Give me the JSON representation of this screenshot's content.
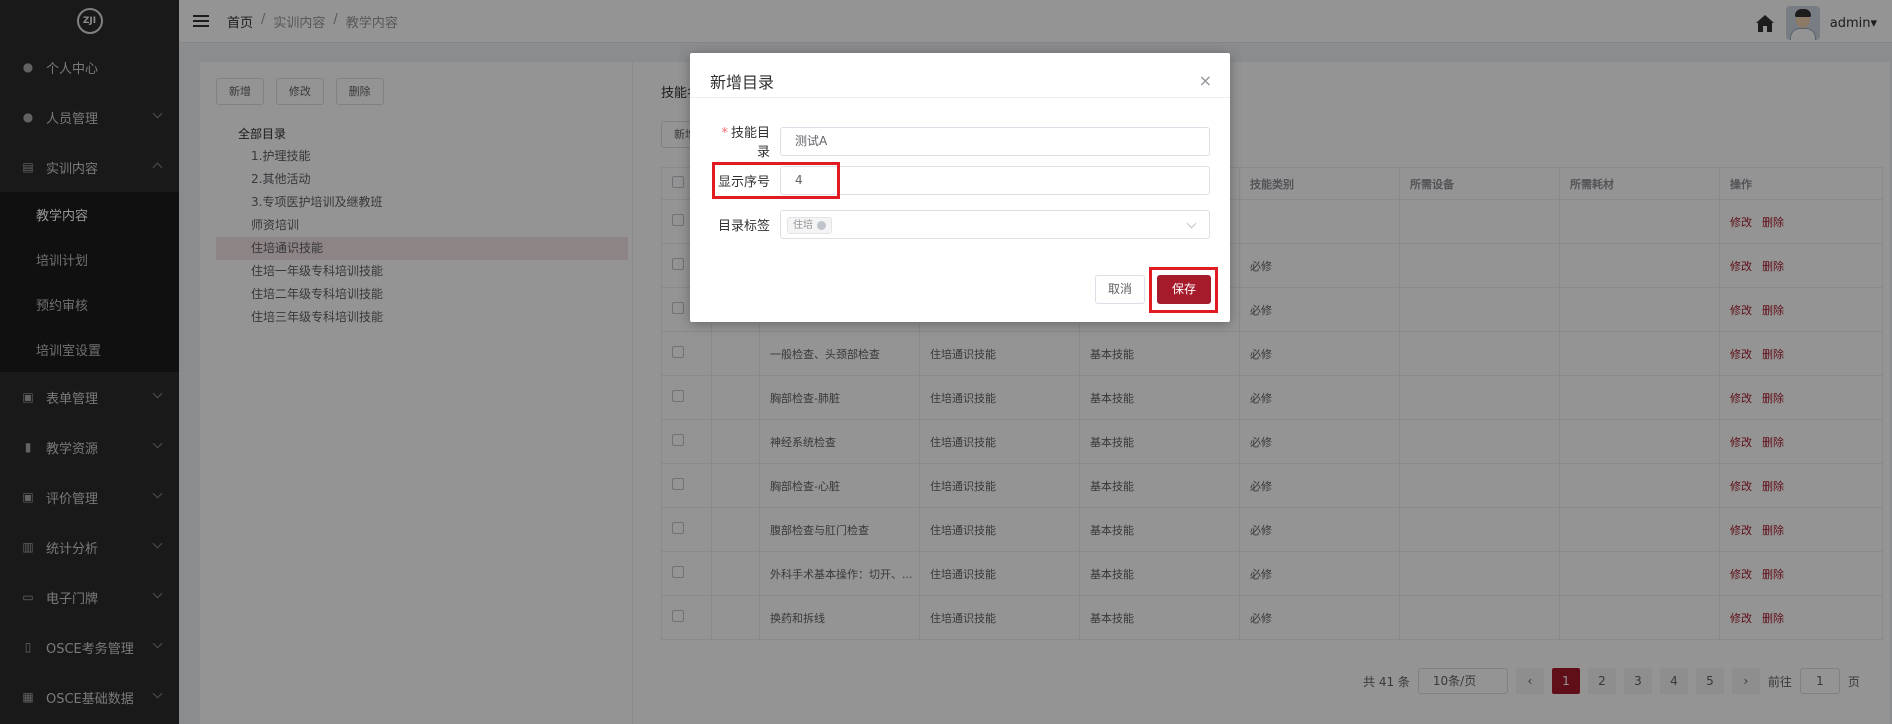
{
  "logo": {
    "text": "ZJI"
  },
  "header": {
    "breadcrumb": [
      "首页",
      "/",
      "实训内容",
      "/",
      "教学内容"
    ],
    "user": "admin▾"
  },
  "sidebar": {
    "items": [
      {
        "label": "个人中心",
        "icon": "user-icon"
      },
      {
        "label": "人员管理",
        "icon": "users-icon"
      },
      {
        "label": "实训内容",
        "icon": "book-icon"
      },
      {
        "label": "表单管理",
        "icon": "form-icon"
      },
      {
        "label": "教学资源",
        "icon": "resource-icon"
      },
      {
        "label": "评价管理",
        "icon": "evaluate-icon"
      },
      {
        "label": "统计分析",
        "icon": "chart-icon"
      },
      {
        "label": "电子门牌",
        "icon": "monitor-icon"
      },
      {
        "label": "OSCE考务管理",
        "icon": "doc-icon"
      },
      {
        "label": "OSCE基础数据",
        "icon": "grid-icon"
      }
    ],
    "sub": [
      "教学内容",
      "培训计划",
      "预约审核",
      "培训室设置"
    ]
  },
  "tree": {
    "buttons": [
      "新增",
      "修改",
      "删除"
    ],
    "root": "全部目录",
    "items": [
      "1.护理技能",
      "2.其他活动",
      "3.专项医护培训及继教班",
      "师资培训",
      "住培通识技能",
      "住培一年级专科培训技能",
      "住培二年级专科培训技能",
      "住培三年级专科培训技能"
    ]
  },
  "table": {
    "title": "技能名",
    "new_btn": "新增",
    "headers": [
      "",
      "",
      "",
      "",
      "",
      "技能类别",
      "所需设备",
      "所需耗材",
      "操作"
    ],
    "rows": [
      {
        "name": "",
        "dir": "",
        "type": "",
        "cat": ""
      },
      {
        "name": "",
        "dir": "",
        "type": "",
        "cat": "必修"
      },
      {
        "name": "",
        "dir": "",
        "type": "",
        "cat": "必修"
      },
      {
        "name": "一般检查、头颈部检查",
        "dir": "住培通识技能",
        "type": "基本技能",
        "cat": "必修"
      },
      {
        "name": "胸部检查-肺脏",
        "dir": "住培通识技能",
        "type": "基本技能",
        "cat": "必修"
      },
      {
        "name": "神经系统检查",
        "dir": "住培通识技能",
        "type": "基本技能",
        "cat": "必修"
      },
      {
        "name": "胸部检查-心脏",
        "dir": "住培通识技能",
        "type": "基本技能",
        "cat": "必修"
      },
      {
        "name": "腹部检查与肛门检查",
        "dir": "住培通识技能",
        "type": "基本技能",
        "cat": "必修"
      },
      {
        "name": "外科手术基本操作：切开、...",
        "dir": "住培通识技能",
        "type": "基本技能",
        "cat": "必修"
      },
      {
        "name": "换药和拆线",
        "dir": "住培通识技能",
        "type": "基本技能",
        "cat": "必修"
      }
    ],
    "edit": "修改",
    "delete": "删除"
  },
  "pager": {
    "total": "共 41 条",
    "size": "10条/页",
    "pages": [
      "1",
      "2",
      "3",
      "4",
      "5"
    ],
    "goto": "前往",
    "page_value": "1",
    "page_unit": "页"
  },
  "dialog": {
    "title": "新增目录",
    "close": "×",
    "field1_label": "技能目录",
    "field1_value": "测试A",
    "field2_label": "显示序号",
    "field2_value": "4",
    "field3_label": "目录标签",
    "field3_tag": "住培",
    "cancel": "取消",
    "save": "保存"
  },
  "colors": {
    "accent": "#a61b2b",
    "sidebar": "#2b2b2b",
    "highlight": "#e01b22"
  }
}
